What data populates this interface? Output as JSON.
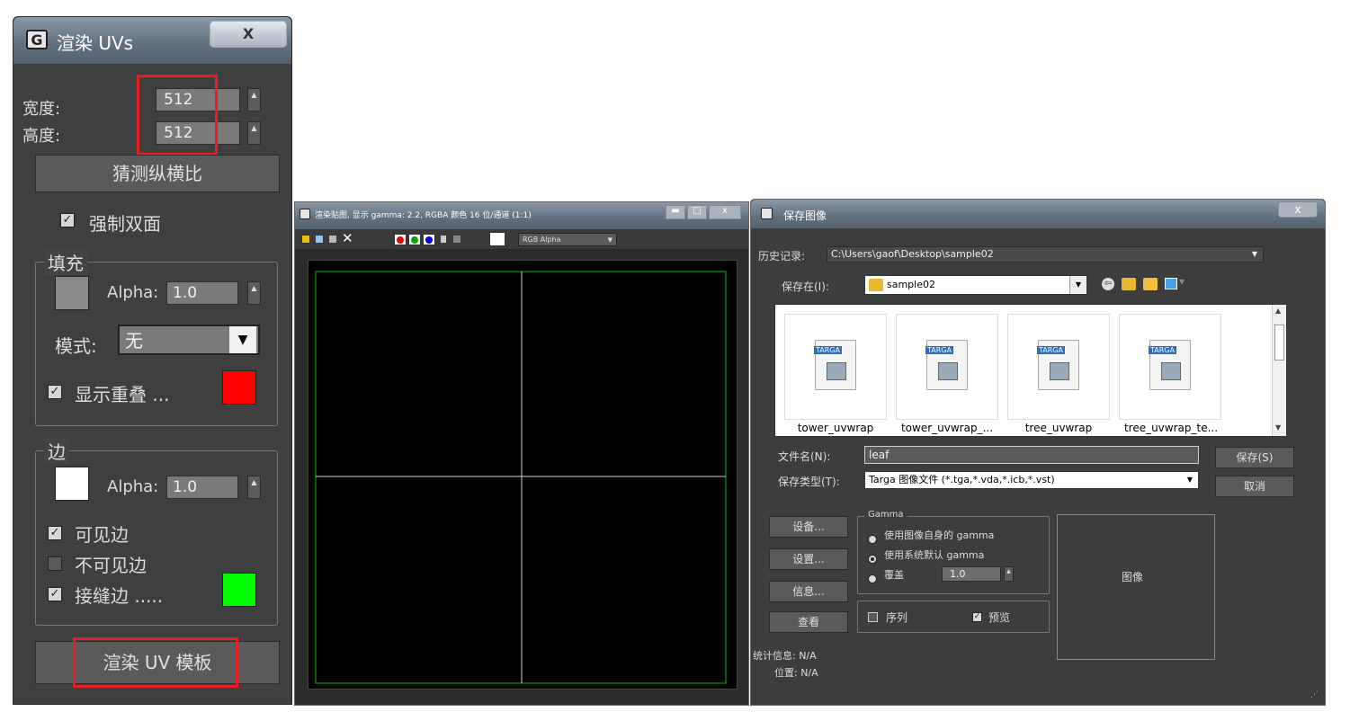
{
  "render_uvs": {
    "title": "渲染 UVs",
    "close_label": "X",
    "width_label": "宽度:",
    "width_value": "512",
    "height_label": "高度:",
    "height_value": "512",
    "guess_aspect_label": "猜测纵横比",
    "force2sided_label": "强制双面",
    "fill_group_label": "填充",
    "fill_alpha_label": "Alpha:",
    "fill_alpha_value": "1.0",
    "mode_label": "模式:",
    "mode_value": "无",
    "show_overlap_label": "显示重叠 ...",
    "edge_group_label": "边",
    "edge_alpha_label": "Alpha:",
    "edge_alpha_value": "1.0",
    "visible_edges_label": "可见边",
    "invisible_edges_label": "不可见边",
    "seam_edges_label": "接缝边 .....",
    "render_button_label": "渲染 UV 模板",
    "colors": {
      "fill": "#8a8a8a",
      "overlap": "#ff0000",
      "edge": "#ffffff",
      "seam": "#00ff00",
      "highlight": "#e81f27"
    }
  },
  "render_frame": {
    "title": "渲染贴图, 显示 gamma: 2.2, RGBA 颜色 16 位/通道 (1:1)",
    "channel_select": "RGB Alpha"
  },
  "save_image": {
    "title": "保存图像",
    "close_label": "x",
    "history_label": "历史记录:",
    "history_value": "C:\\Users\\gaof\\Desktop\\sample02",
    "save_in_label": "保存在(I):",
    "save_in_value": "sample02",
    "files": [
      {
        "name": "tower_uvwrap",
        "icon": "targa-file-icon",
        "badge": "TARGA"
      },
      {
        "name": "tower_uvwrap_...",
        "icon": "targa-file-icon",
        "badge": "TARGA"
      },
      {
        "name": "tree_uvwrap",
        "icon": "targa-file-icon",
        "badge": "TARGA"
      },
      {
        "name": "tree_uvwrap_te...",
        "icon": "targa-file-icon",
        "badge": "TARGA"
      }
    ],
    "filename_label": "文件名(N):",
    "filename_value": "leaf",
    "filetype_label": "保存类型(T):",
    "filetype_value": "Targa 图像文件 (*.tga,*.vda,*.icb,*.vst)",
    "save_button": "保存(S)",
    "cancel_button": "取消",
    "devices_button": "设备...",
    "setup_button": "设置...",
    "info_button": "信息...",
    "view_button": "查看",
    "gamma_group_label": "Gamma",
    "gamma_option_own": "使用图像自身的 gamma",
    "gamma_option_system": "使用系统默认 gamma",
    "gamma_option_override": "覆盖",
    "gamma_override_value": "1.0",
    "sequence_label": "序列",
    "preview_label": "预览",
    "image_label": "图像",
    "stats_label": "统计信息: N/A",
    "location_label": "位置: N/A"
  }
}
